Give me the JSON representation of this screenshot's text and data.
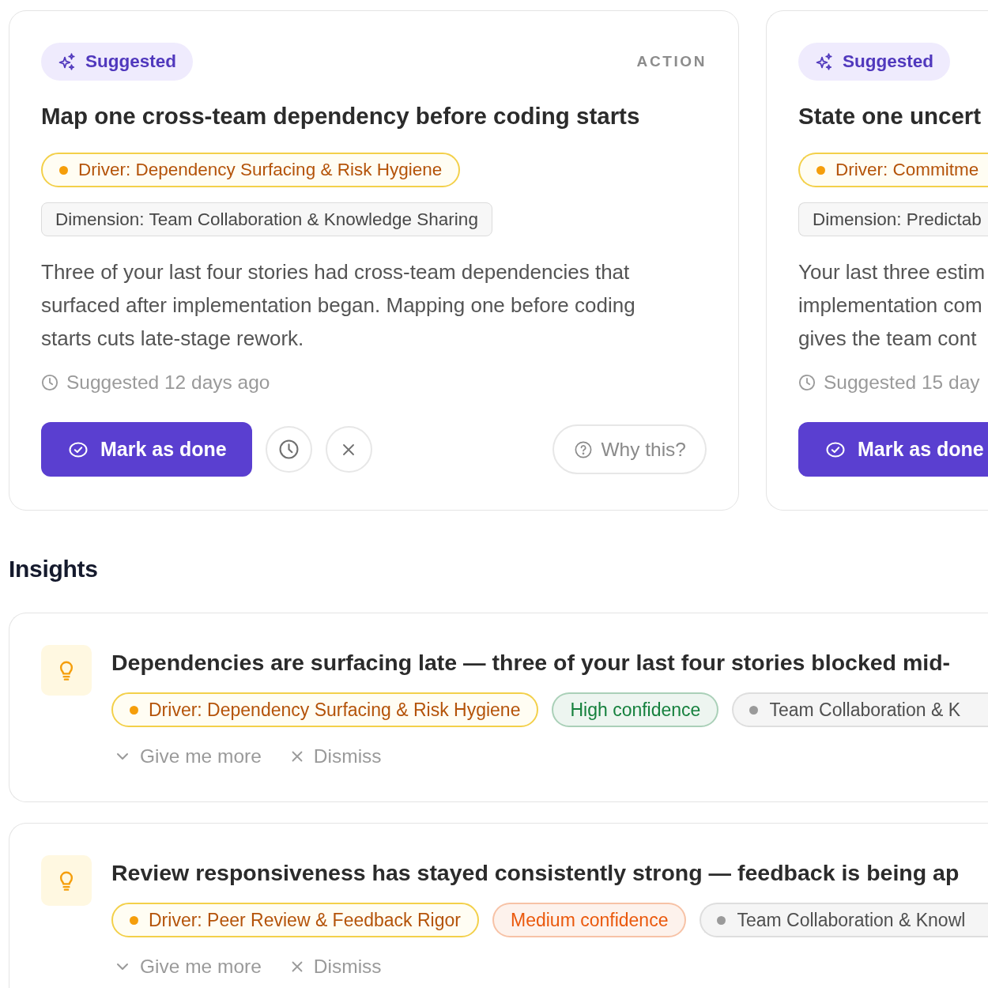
{
  "actions": [
    {
      "badge": "Suggested",
      "category": "ACTION",
      "title": "Map one cross-team dependency before coding starts",
      "driver": "Driver: Dependency Surfacing & Risk Hygiene",
      "dimension": "Dimension: Team Collaboration & Knowledge Sharing",
      "description_lines": [
        "Three of your last four stories had cross-team dependencies that",
        "surfaced after implementation began. Mapping one before coding",
        "starts cuts late-stage rework."
      ],
      "suggested_at": "Suggested 12 days ago",
      "primary_button": "Mark as done",
      "icon_buttons": [
        {
          "kind": "snooze"
        },
        {
          "kind": "dismiss"
        }
      ],
      "why_button": "Why this?"
    },
    {
      "badge": "Suggested",
      "title": "State one uncert",
      "driver": "Driver: Commitme",
      "dimension": "Dimension: Predictab",
      "description_lines": [
        "Your last three estim",
        "implementation com",
        "gives the team cont"
      ],
      "suggested_at": "Suggested 15 day",
      "primary_button": "Mark as done"
    }
  ],
  "insights_heading": "Insights",
  "insights": [
    {
      "title": "Dependencies are surfacing late — three of your last four stories blocked mid-",
      "driver": "Driver: Dependency Surfacing & Risk Hygiene",
      "confidence": {
        "label": "High confidence",
        "color": "#15803d"
      },
      "dimension": "Team Collaboration & K",
      "more_button": "Give me more",
      "dismiss_button": "Dismiss"
    },
    {
      "title": "Review responsiveness has stayed consistently strong — feedback is being ap",
      "driver": "Driver: Peer Review & Feedback Rigor",
      "confidence": {
        "label": "Medium confidence",
        "color": "#ea580c"
      },
      "dimension": "Team Collaboration & Knowl",
      "more_button": "Give me more",
      "dismiss_button": "Dismiss"
    }
  ]
}
